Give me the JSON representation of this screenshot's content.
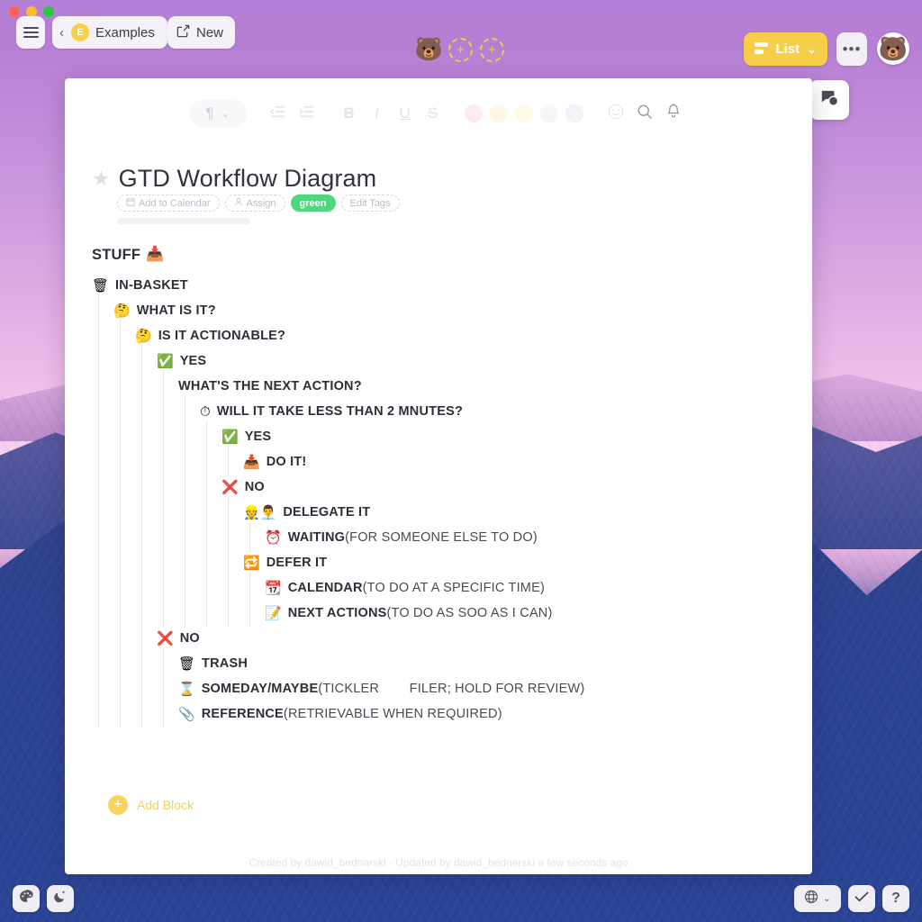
{
  "window": {
    "traffic_lights": [
      "#ff5f57",
      "#febc2e",
      "#28c840"
    ]
  },
  "topbar": {
    "menu_icon": "hamburger-icon",
    "back_chevron": "‹",
    "workspace_initial": "E",
    "workspace_label": "Examples",
    "new_icon": "↗",
    "new_label": "New",
    "workspace_avatar": "🐻",
    "add_workspace_glyph": "+",
    "view_icon": "list-glyph",
    "view_label": "List",
    "view_chevron": "⌄",
    "more_label": "•••",
    "user_avatar": "🐻"
  },
  "doc_toolbar": {
    "paragraph_glyph": "¶",
    "paragraph_chevron": "⌄",
    "outdent_glyph": "←|",
    "indent_glyph": "|→",
    "bold": "B",
    "italic": "I",
    "underline": "U",
    "strike": "S",
    "colors": [
      "#f7dce8",
      "#fbf2cf",
      "#fbf7d2",
      "#eeeef4",
      "#eaeaf4"
    ],
    "emoji_glyph": "☺",
    "search_glyph": "search-icon",
    "bell_glyph": "bell-icon"
  },
  "comments_fab": {
    "icon": "comment-bubbles-icon"
  },
  "document": {
    "star": "★",
    "title": "GTD Workflow Diagram",
    "chips": [
      {
        "name": "add-to-calendar",
        "icon": "🗓",
        "label": "Add to Calendar",
        "style": "dashed"
      },
      {
        "name": "assign",
        "icon": "☺",
        "label": "Assign",
        "style": "dashed"
      },
      {
        "name": "tag-green",
        "icon": "",
        "label": "green",
        "style": "solid"
      },
      {
        "name": "edit-tags",
        "icon": "",
        "label": "Edit Tags",
        "style": "dashed"
      }
    ],
    "outline": [
      {
        "id": "stuff",
        "depth": 0,
        "emoji": "📥",
        "emoji_after": true,
        "label": "STUFF",
        "paren": ""
      },
      {
        "id": "in-basket",
        "depth": 0,
        "emoji": "🗑",
        "label": "IN-BASKET",
        "paren": ""
      },
      {
        "id": "what-is-it",
        "depth": 1,
        "emoji": "🤔",
        "label": "WHAT IS IT?",
        "paren": ""
      },
      {
        "id": "is-actionable",
        "depth": 2,
        "emoji": "🤔",
        "label": "IS IT ACTIONABLE?",
        "paren": ""
      },
      {
        "id": "yes-1",
        "depth": 3,
        "emoji": "✅",
        "label": "YES",
        "paren": ""
      },
      {
        "id": "next-action",
        "depth": 4,
        "emoji": "",
        "label": "WHAT'S THE NEXT ACTION?",
        "paren": ""
      },
      {
        "id": "two-minutes",
        "depth": 5,
        "emoji": "⏱",
        "label": "WILL IT TAKE LESS THAN 2 MNUTES?",
        "paren": ""
      },
      {
        "id": "yes-2",
        "depth": 6,
        "emoji": "✅",
        "label": "YES",
        "paren": ""
      },
      {
        "id": "do-it",
        "depth": 7,
        "emoji": "📥",
        "label": "DO IT!",
        "paren": ""
      },
      {
        "id": "no-1",
        "depth": 6,
        "emoji": "❌",
        "label": "NO",
        "paren": ""
      },
      {
        "id": "delegate-it",
        "depth": 7,
        "emoji": "👷👨‍💼",
        "label": "DELEGATE IT",
        "paren": ""
      },
      {
        "id": "waiting",
        "depth": 8,
        "emoji": "⏰",
        "label": "WAITING",
        "paren": " (FOR SOMEONE ELSE TO DO)"
      },
      {
        "id": "defer-it",
        "depth": 7,
        "emoji": "🔁",
        "label": "DEFER IT",
        "paren": ""
      },
      {
        "id": "calendar",
        "depth": 8,
        "emoji": "📆",
        "label": "CALENDAR",
        "paren": " (TO DO AT A SPECIFIC TIME)"
      },
      {
        "id": "next-actions",
        "depth": 8,
        "emoji": "📝",
        "label": "NEXT ACTIONS",
        "paren": " (TO DO AS SOO AS I CAN)"
      },
      {
        "id": "no-2",
        "depth": 3,
        "emoji": "❌",
        "label": "NO",
        "paren": ""
      },
      {
        "id": "trash",
        "depth": 4,
        "emoji": "🗑",
        "label": "TRASH",
        "paren": ""
      },
      {
        "id": "someday",
        "depth": 4,
        "emoji": "⌛",
        "label": "SOMEDAY/MAYBE",
        "paren": " (TICKLER   FILER; HOLD FOR REVIEW)"
      },
      {
        "id": "reference",
        "depth": 4,
        "emoji": "📎",
        "label": "REFERENCE",
        "paren": " (RETRIEVABLE WHEN REQUIRED)"
      }
    ],
    "add_block": {
      "plus": "+",
      "label": "Add Block"
    },
    "footer": "Created by dawid_bednarski · Updated by dawid_bednarski a few seconds ago"
  },
  "bottom_left": [
    {
      "name": "theme-palette-button",
      "glyph": "🎨"
    },
    {
      "name": "dark-mode-button",
      "glyph": "🌙"
    }
  ],
  "bottom_right": {
    "language_glyph": "🌐",
    "language_chevron": "⌄",
    "confirm_glyph": "✓",
    "help_glyph": "?"
  },
  "colors": {
    "accent_yellow": "#f6ce4a",
    "tag_green": "#4fd67f",
    "panel": "#ffffff"
  }
}
